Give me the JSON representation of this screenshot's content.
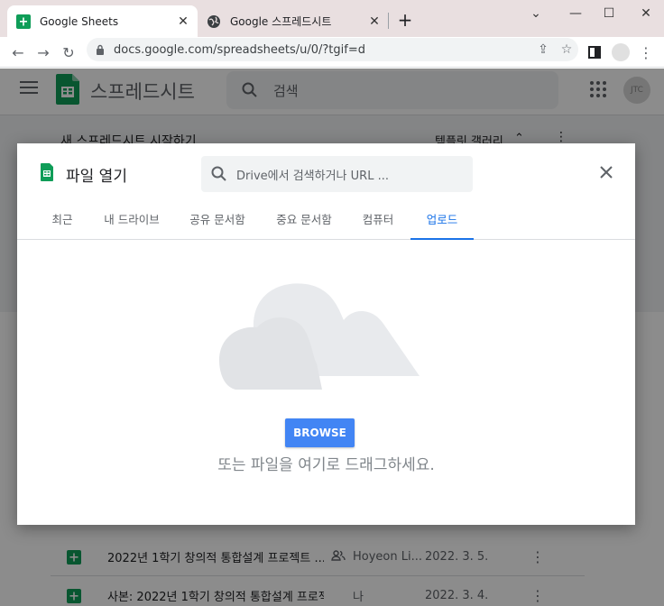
{
  "browser": {
    "tabs": [
      {
        "label": "Google Sheets",
        "active": true
      },
      {
        "label": "Google 스프레드시트",
        "active": false
      }
    ],
    "url": "docs.google.com/spreadsheets/u/0/?tgif=d"
  },
  "app": {
    "name": "스프레드시트",
    "search_placeholder": "검색",
    "avatar_initials": "JTC",
    "start_title": "새 스프레드시트 시작하기",
    "template_gallery": "템플릿 갤러리",
    "files": [
      {
        "name": "2022년 1학기 창의적 통합설계 프로젝트 ...",
        "owner": "Hoyeon Li...",
        "shared": true,
        "date": "2022. 3. 5."
      },
      {
        "name": "사본: 2022년 1학기 창의적 통합설계 프로젝트...",
        "owner": "나",
        "shared": false,
        "date": "2022. 3. 4."
      }
    ]
  },
  "dialog": {
    "title": "파일 열기",
    "search_placeholder": "Drive에서 검색하거나 URL ...",
    "tabs": [
      {
        "label": "최근"
      },
      {
        "label": "내 드라이브"
      },
      {
        "label": "공유 문서함"
      },
      {
        "label": "중요 문서함"
      },
      {
        "label": "컴퓨터"
      },
      {
        "label": "업로드",
        "selected": true
      }
    ],
    "browse_label": "BROWSE",
    "drop_hint": "또는 파일을 여기로 드래그하세요."
  },
  "colors": {
    "accent": "#1a73e8",
    "browse": "#4285f4",
    "sheets_green": "#0f9d58"
  }
}
